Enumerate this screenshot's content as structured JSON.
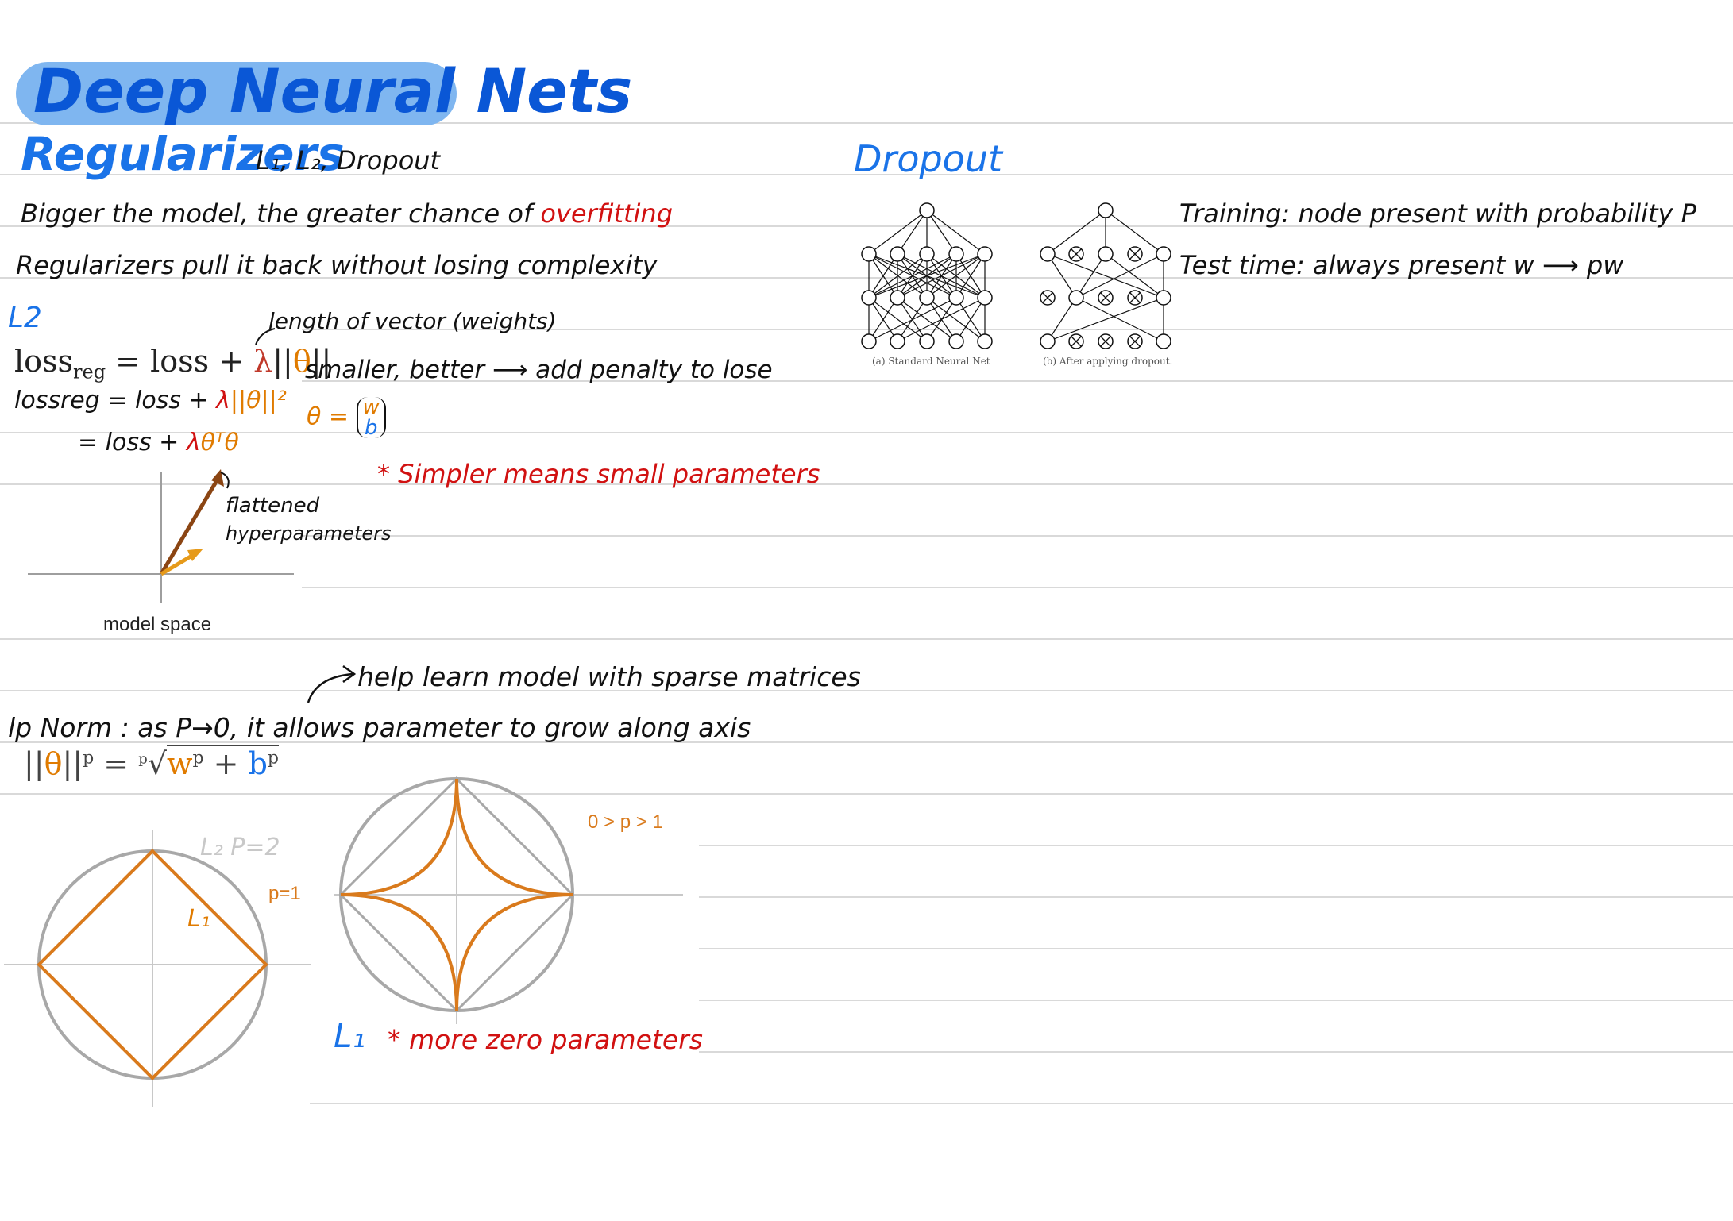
{
  "header": {
    "title": "Deep Neural Nets",
    "section_title": "Regularizers",
    "section_subtitle": "L₁, L₂, Dropout"
  },
  "intro": {
    "line1_prefix": "Bigger the model, the greater chance of",
    "line1_highlight": "overfitting",
    "line2": "Regularizers pull it back without losing complexity"
  },
  "l2": {
    "heading": "L2",
    "length_note": "length of vector (weights)",
    "formula_main_prefix": "loss",
    "formula_main_sub": "reg",
    "formula_main_mid": " = loss + ",
    "formula_main_lambda": "λ",
    "formula_main_norm_open": "||",
    "formula_main_theta": "θ",
    "formula_main_norm_close": "||",
    "formula_line2_prefix": "lossreg = loss + ",
    "formula_line2_lambda": "λ",
    "formula_line2_norm": "||θ||²",
    "formula_line3_prefix": "= loss + ",
    "formula_line3_lambda": "λ",
    "formula_line3_theta": "θᵀθ",
    "smaller_note": "smaller, better ⟶ add penalty to lose",
    "theta_eq": "θ =",
    "theta_w": "w",
    "theta_b": "b",
    "simpler_note": "* Simpler means small parameters",
    "flattened_note_1": "flattened",
    "flattened_note_2": "hyperparameters",
    "model_space_label": "model space"
  },
  "lp": {
    "sparse_note": "help learn model with sparse matrices",
    "heading": "lp Norm : as P→0, it allows parameter to grow along axis",
    "formula_norm": "||θ||",
    "formula_p": "p",
    "formula_eq": " = ",
    "formula_root_index": "p",
    "formula_w": "w",
    "formula_plus": " + ",
    "formula_b": "b",
    "l2_label": "L₂ P=2",
    "l1_label": "L₁",
    "p1_label": "p=1",
    "range_label": "0 > p > 1",
    "l1_bottom": "L₁",
    "zero_note": "* more zero parameters"
  },
  "dropout": {
    "heading": "Dropout",
    "caption_a": "(a) Standard Neural Net",
    "caption_b": "(b) After applying dropout.",
    "training_note": "Training: node present with probability P",
    "test_note": "Test time: always present  w ⟶ pw"
  },
  "colors": {
    "title_bar": "#7fb6f0",
    "heading_blue": "#1a73e8",
    "highlight_red": "#d11111",
    "orange": "#e07b00",
    "ruled_line": "#d9d9d9"
  }
}
